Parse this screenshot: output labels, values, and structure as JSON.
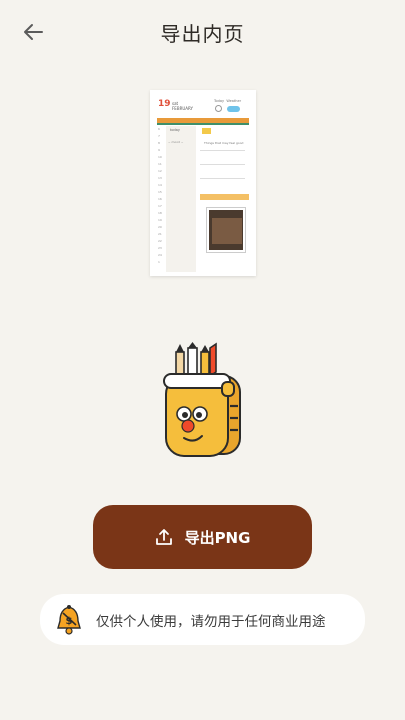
{
  "header": {
    "title": "导出内页",
    "back_icon": "arrow-left-icon"
  },
  "preview": {
    "date_number": "19",
    "month_label_line1": "sat",
    "month_label_line2": "FEBRUARY",
    "weather_label_1": "Today",
    "weather_label_2": "Weather",
    "today_label": "today",
    "scribble": "~ mood ~",
    "note_text": "Things that may feel good",
    "accent_color": "#e0503a"
  },
  "mascot": {
    "icon": "mascot-character-icon",
    "colors": {
      "body": "#f5be3c",
      "nose": "#ef4a2a"
    }
  },
  "export_button": {
    "icon": "upload-icon",
    "label": "导出PNG",
    "color": "#7a3517"
  },
  "notice": {
    "icon": "bell-warning-icon",
    "text": "仅供个人使用，请勿用于任何商业用途"
  }
}
